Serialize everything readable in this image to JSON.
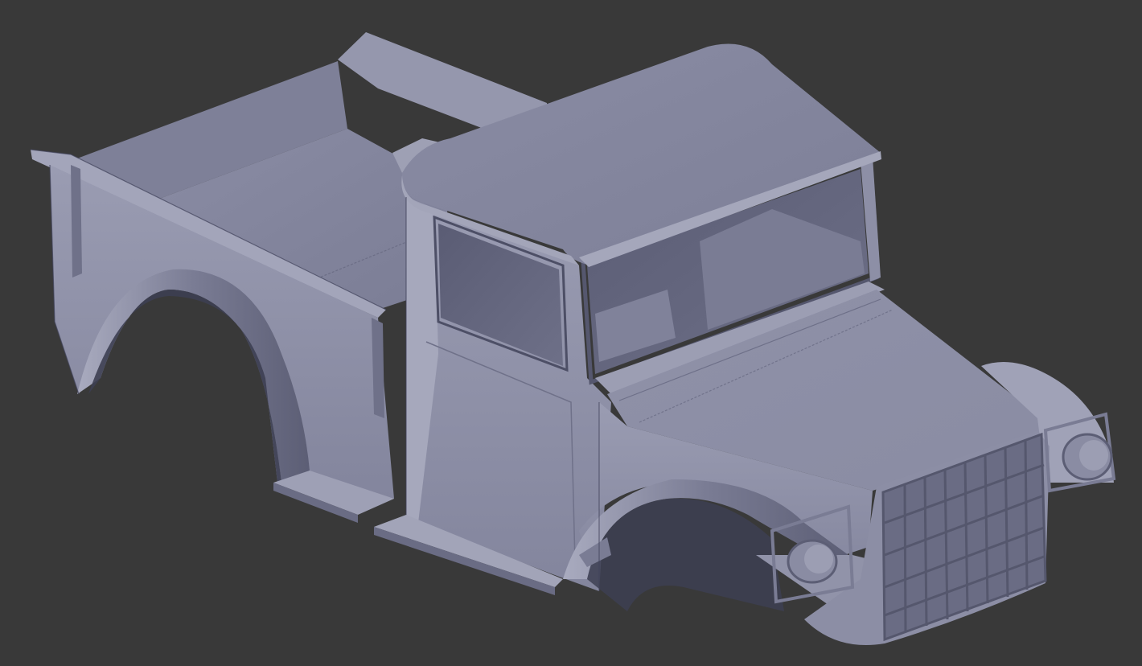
{
  "viewport": {
    "background_color": "#393939",
    "model": {
      "subject": "pickup-truck-body-mesh",
      "shading": "solid",
      "base_color": "#8c8ea6",
      "light_color": "#a7a9bd",
      "shadow_color": "#5b5d74",
      "dark_color": "#44465a",
      "edge_color": "#3c3e50"
    }
  }
}
